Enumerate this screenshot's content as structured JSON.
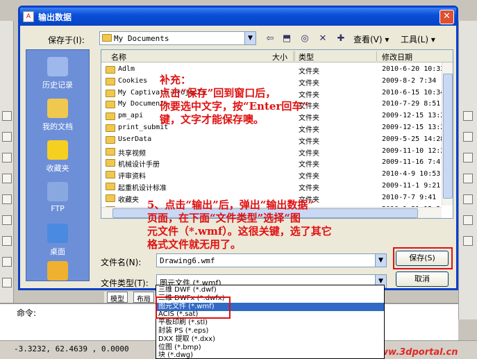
{
  "window": {
    "title": "输出数据",
    "close_glyph": "✕"
  },
  "toolbar": {
    "save_in_label": "保存于(I):",
    "save_in_value": "My Documents",
    "view_label": "查看(V) ▾",
    "tools_label": "工具(L) ▾"
  },
  "places": [
    {
      "label": "历史记录",
      "color": "#9fb8ec"
    },
    {
      "label": "我的文档",
      "color": "#f0c850"
    },
    {
      "label": "收藏夹",
      "color": "#f6d020"
    },
    {
      "label": "FTP",
      "color": "#8aa8e0"
    },
    {
      "label": "桌面",
      "color": "#4a8ae0"
    },
    {
      "label": "",
      "color": "#f0b030"
    }
  ],
  "file_list": {
    "columns": [
      "名称",
      "大小",
      "类型",
      "修改日期"
    ],
    "rows": [
      {
        "name": "Adlm",
        "size": "",
        "type": "文件夹",
        "date": "2010-6-20 10:33"
      },
      {
        "name": "Cookies",
        "size": "",
        "type": "文件夹",
        "date": "2009-8-2 7:34"
      },
      {
        "name": "My Captivate Projects",
        "size": "",
        "type": "文件夹",
        "date": "2010-6-15 10:34"
      },
      {
        "name": "My Documents",
        "size": "",
        "type": "文件夹",
        "date": "2010-7-29 8:51"
      },
      {
        "name": "pm_api",
        "size": "",
        "type": "文件夹",
        "date": "2009-12-15 13:2"
      },
      {
        "name": "print_submit",
        "size": "",
        "type": "文件夹",
        "date": "2009-12-15 13:2"
      },
      {
        "name": "UserData",
        "size": "",
        "type": "文件夹",
        "date": "2009-5-25 14:28"
      },
      {
        "name": "共享视频",
        "size": "",
        "type": "文件夹",
        "date": "2009-11-10 12:2"
      },
      {
        "name": "机械设计手册",
        "size": "",
        "type": "文件夹",
        "date": "2009-11-16 7:4"
      },
      {
        "name": "评审资料",
        "size": "",
        "type": "文件夹",
        "date": "2010-4-9 10:53"
      },
      {
        "name": "起重机设计标准",
        "size": "",
        "type": "文件夹",
        "date": "2009-11-1 9:21"
      },
      {
        "name": "收藏夹",
        "size": "",
        "type": "文件夹",
        "date": "2010-7-7 9:41"
      },
      {
        "name": "图片收藏",
        "size": "",
        "type": "文件夹",
        "date": "2010-1-31 12:3"
      }
    ]
  },
  "form": {
    "filename_label": "文件名(N):",
    "filename_value": "Drawing6.wmf",
    "filetype_label": "文件类型(T):",
    "filetype_value": "图元文件 (*.wmf)",
    "save_button": "保存(S)",
    "cancel_button": "取消"
  },
  "dropdown_options": [
    "三维 DWF (*.dwf)",
    "三维 DWFx (*.dwfx)",
    "图元文件 (*.wmf)",
    "ACIS (*.sat)",
    "平板印刷 (*.stl)",
    "封装 PS (*.eps)",
    "DXX 提取 (*.dxx)",
    "位图 (*.bmp)",
    "块 (*.dwg)"
  ],
  "dropdown_selected_index": 2,
  "annotations": {
    "note1": "补充：\n点击“保存”回到窗口后，\n你要选中文字，按“Enter回车”\n键，文字才能保存噢。",
    "note2": "5、点击“输出”后，弹出“输出数据”\n页面，在下面“文件类型”选择“图\n元文件（*.wmf）。这很关键，选了其它\n格式文件就无用了。"
  },
  "cad": {
    "layout_tabs": [
      "模型",
      "布局"
    ],
    "command_label": "命令:",
    "coordinates": "-3.3232,  62.4639 , 0.0000",
    "watermark": "三维网www.3dportal.cn"
  },
  "colors": {
    "title_bar": "#0a4fd8",
    "annotation": "#e01010",
    "selection": "#316ac5"
  }
}
